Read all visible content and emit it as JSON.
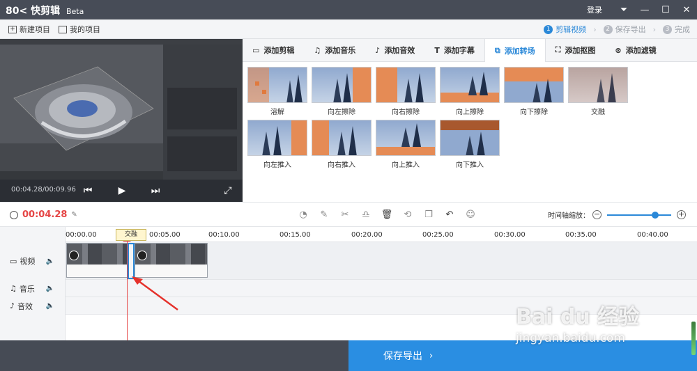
{
  "app": {
    "title": "快剪辑",
    "badge": "Beta",
    "login_label": "登录"
  },
  "toolbar": {
    "new_project": "新建项目",
    "my_projects": "我的项目"
  },
  "steps": [
    {
      "num": "1",
      "label": "剪辑视频",
      "active": true
    },
    {
      "num": "2",
      "label": "保存导出",
      "active": false
    },
    {
      "num": "3",
      "label": "完成",
      "active": false
    }
  ],
  "preview": {
    "time": "00:04.28/00:09.96"
  },
  "tabs": [
    {
      "label": "添加剪辑",
      "icon": "video-icon"
    },
    {
      "label": "添加音乐",
      "icon": "music-icon"
    },
    {
      "label": "添加音效",
      "icon": "sound-effect-icon"
    },
    {
      "label": "添加字幕",
      "icon": "text-icon"
    },
    {
      "label": "添加转场",
      "icon": "transition-icon",
      "active": true
    },
    {
      "label": "添加抠图",
      "icon": "cutout-icon"
    },
    {
      "label": "添加滤镜",
      "icon": "filter-icon"
    }
  ],
  "transitions": [
    {
      "label": "溶解"
    },
    {
      "label": "向左擦除"
    },
    {
      "label": "向右擦除"
    },
    {
      "label": "向上擦除"
    },
    {
      "label": "向下擦除"
    },
    {
      "label": "交融"
    },
    {
      "label": "向左推入"
    },
    {
      "label": "向右推入"
    },
    {
      "label": "向上推入"
    },
    {
      "label": "向下推入"
    }
  ],
  "timeline": {
    "current_time": "00:04.28",
    "zoom_label": "时间轴缩放：",
    "ruler": [
      "00:00.00",
      "00:05.00",
      "00:10.00",
      "00:15.00",
      "00:20.00",
      "00:25.00",
      "00:30.00",
      "00:35.00",
      "00:40.00"
    ],
    "tooltip": "交融",
    "tracks": {
      "video": "视频",
      "music": "音乐",
      "effects": "音效"
    }
  },
  "bottom": {
    "save_label": "保存导出"
  },
  "watermark": {
    "logo": "Bai du 经验",
    "url": "jingyan.baidu.com"
  },
  "colors": {
    "accent": "#2a88d8",
    "playhead": "#e54545",
    "titlebar": "#474c57"
  }
}
